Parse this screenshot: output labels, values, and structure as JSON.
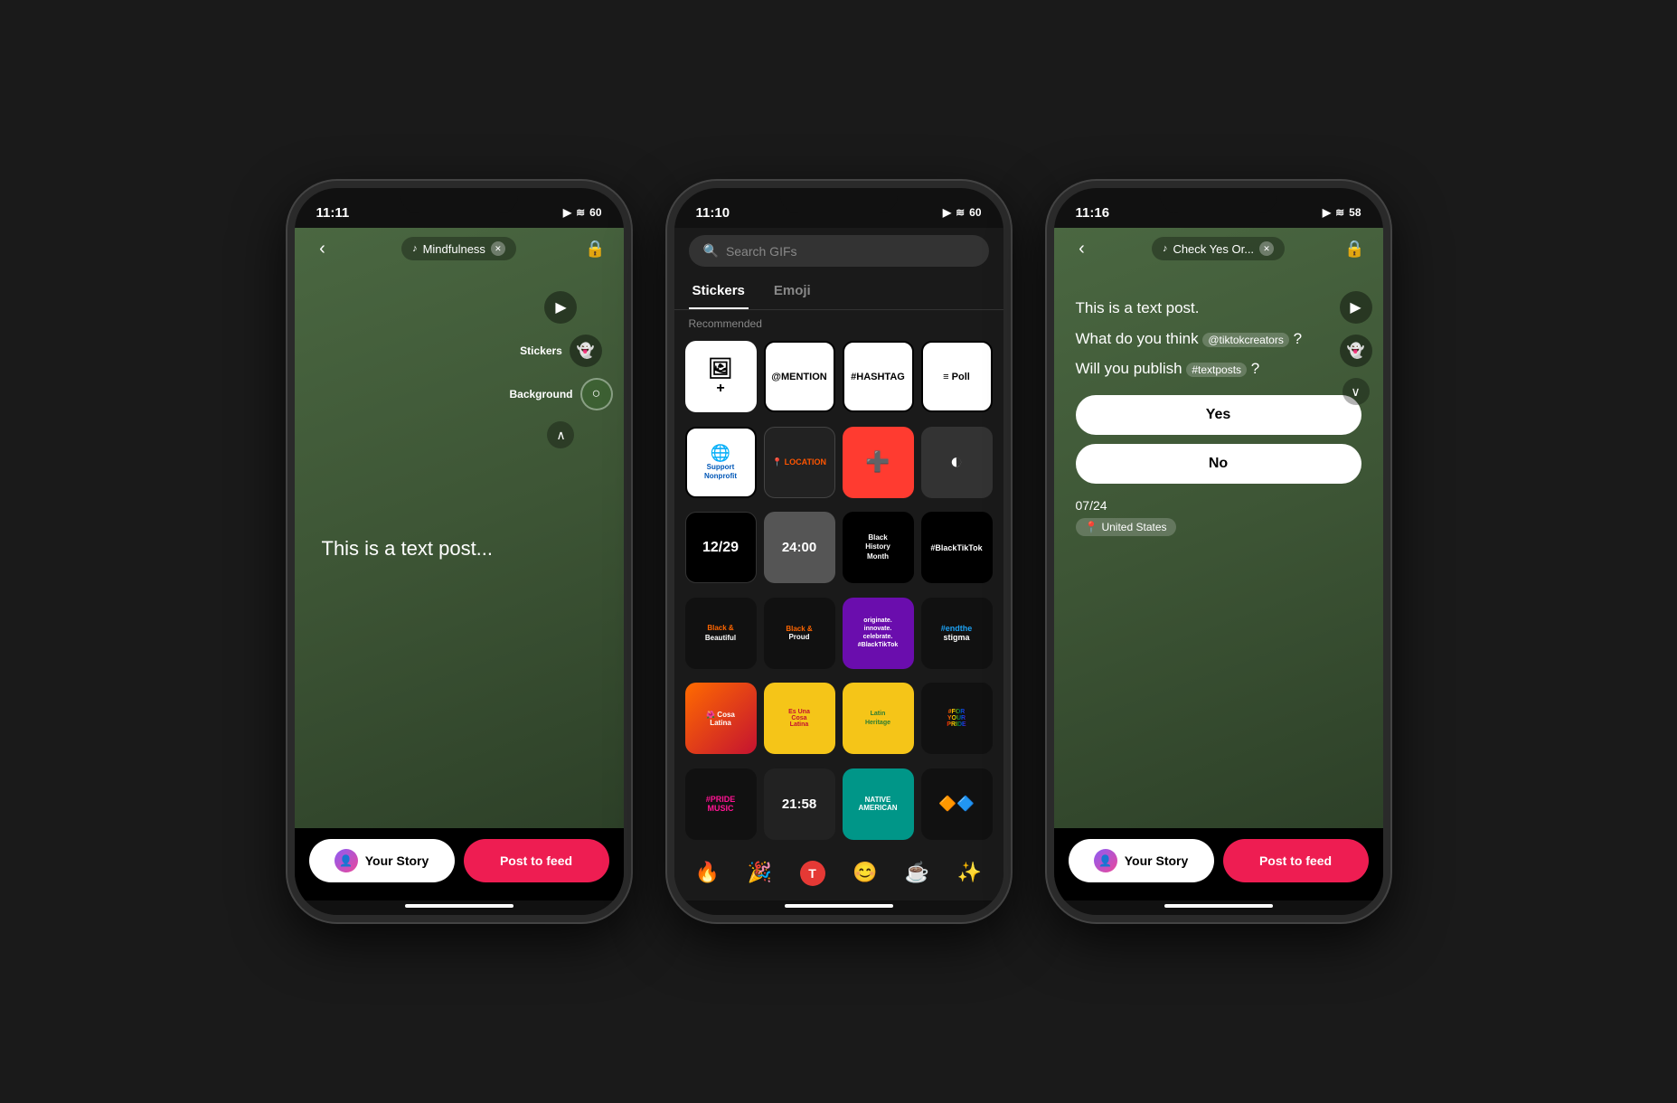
{
  "phones": [
    {
      "id": "phone1",
      "status_bar": {
        "time": "11:11",
        "icons": "▶ ≋ 60"
      },
      "nav": {
        "back": "‹",
        "pill_text": "Mindfulness",
        "pill_icon": "♪",
        "lock_icon": "🔒"
      },
      "toolbar": {
        "video_icon": "▶",
        "stickers_label": "Stickers",
        "stickers_icon": "👻",
        "background_label": "Background",
        "background_icon": "○",
        "collapse_icon": "∧"
      },
      "content": {
        "text": "This is a text post..."
      },
      "bottom": {
        "story_label": "Your Story",
        "feed_label": "Post to feed"
      }
    },
    {
      "id": "phone2",
      "status_bar": {
        "time": "11:10",
        "icons": "▶ ≋ 60"
      },
      "search": {
        "placeholder": "Search GIFs"
      },
      "tabs": [
        {
          "label": "Stickers",
          "active": true
        },
        {
          "label": "Emoji",
          "active": false
        }
      ],
      "recommended_label": "Recommended",
      "stickers": [
        {
          "id": "add-photo",
          "type": "add-photo",
          "symbol": "🖼+",
          "label": ""
        },
        {
          "id": "mention",
          "type": "mention",
          "text": "@MENTION",
          "label": "@MENTION"
        },
        {
          "id": "hashtag",
          "type": "hashtag",
          "text": "#HASHTAG",
          "label": "#HASHTAG"
        },
        {
          "id": "poll",
          "type": "poll",
          "text": "≡ Poll",
          "label": "Poll"
        },
        {
          "id": "nonprofit",
          "type": "nonprofit",
          "text": "Support Nonprofit",
          "label": "Support Nonprofit"
        },
        {
          "id": "location",
          "type": "location",
          "text": "📍 LOCATION",
          "label": "Location"
        },
        {
          "id": "health",
          "type": "health",
          "text": "➕",
          "label": "Health"
        },
        {
          "id": "circle",
          "type": "circle",
          "text": "◐",
          "label": "Circle"
        },
        {
          "id": "date1229",
          "type": "date",
          "text": "12/29",
          "label": "12/29"
        },
        {
          "id": "time2400",
          "type": "time",
          "text": "24:00",
          "label": "24:00"
        },
        {
          "id": "bhm",
          "type": "bhm",
          "text": "Black History Month",
          "label": "Black History Month"
        },
        {
          "id": "blacktiktok",
          "type": "blacktiktok",
          "text": "#BlackTikTok",
          "label": "#BlackTikTok"
        },
        {
          "id": "bb",
          "type": "bb",
          "text": "Black & Beautiful",
          "label": "Black & Beautiful"
        },
        {
          "id": "bp",
          "type": "bp",
          "text": "Black & Proud",
          "label": "Black & Proud"
        },
        {
          "id": "originate",
          "type": "originate",
          "text": "originate. innovate. celebrate. #BlackTikTok",
          "label": "originate"
        },
        {
          "id": "endthe",
          "type": "endthe",
          "text": "#endthe stigma",
          "label": "#endthestigma"
        },
        {
          "id": "cosa1",
          "type": "cosa1",
          "text": "Cosa Latina",
          "label": "Cosa Latina 1"
        },
        {
          "id": "cosa2",
          "type": "cosa2",
          "text": "Es Una Cosa Latina",
          "label": "Cosa Latina 2"
        },
        {
          "id": "latinheritage",
          "type": "latinheritage",
          "text": "Latin Heritage",
          "label": "Latin Heritage"
        },
        {
          "id": "foryourpride",
          "type": "foryourpride",
          "text": "#FOR YOUR PRIDE",
          "label": "#ForYourPride"
        },
        {
          "id": "pridemusic",
          "type": "pridemusic",
          "text": "#PRIDE MUSIC",
          "label": "#Pride Music"
        },
        {
          "id": "time2158",
          "type": "time2",
          "text": "21:58",
          "label": "21:58"
        },
        {
          "id": "native",
          "type": "native",
          "text": "NATIVE AMERICAN",
          "label": "Native American"
        },
        {
          "id": "decor",
          "type": "decor",
          "text": "🔶🔷🔸",
          "label": "Decoration"
        }
      ],
      "emojis": [
        "🔥",
        "🎉",
        "🅣",
        "😊",
        "☕",
        "✨"
      ]
    },
    {
      "id": "phone3",
      "status_bar": {
        "time": "11:16",
        "icons": "▶ ≋ 58"
      },
      "nav": {
        "back": "‹",
        "pill_text": "Check Yes Or...",
        "pill_icon": "♪",
        "lock_icon": "🔒"
      },
      "toolbar": {
        "video_icon": "▶",
        "stickers_icon": "👻",
        "chevron_down": "∨"
      },
      "content": {
        "line1": "This is a text post.",
        "line2": "What do you think ",
        "mention1": "@tiktokcreators",
        "line2_end": "?",
        "line3": "Will you publish ",
        "mention2": "#textposts",
        "line3_end": "?"
      },
      "poll": {
        "option1": "Yes",
        "option2": "No"
      },
      "meta": {
        "date": "07/24",
        "location": "United States",
        "location_icon": "📍"
      },
      "bottom": {
        "story_label": "Your Story",
        "feed_label": "Post to feed"
      }
    }
  ]
}
